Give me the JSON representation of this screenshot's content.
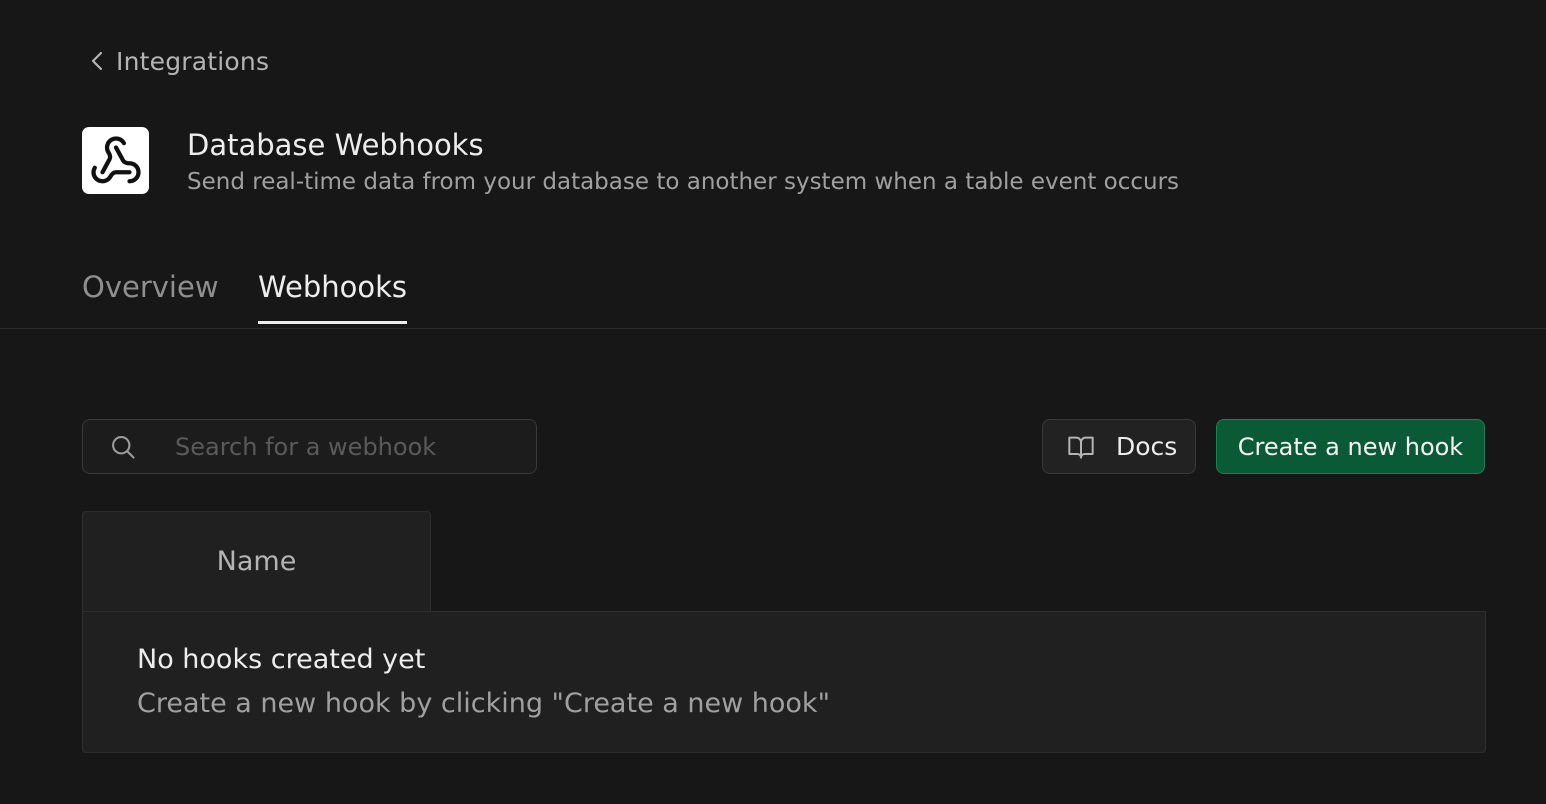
{
  "breadcrumb": {
    "back_label": "Integrations",
    "back_icon": "chevron-left-icon"
  },
  "header": {
    "logo_icon": "webhook-icon",
    "title": "Database Webhooks",
    "subtitle": "Send real-time data from your database to another system when a table event occurs"
  },
  "tabs": [
    {
      "label": "Overview",
      "active": false
    },
    {
      "label": "Webhooks",
      "active": true
    }
  ],
  "toolbar": {
    "search": {
      "placeholder": "Search for a webhook",
      "value": "",
      "icon": "search-icon"
    },
    "docs_label": "Docs",
    "docs_icon": "book-icon",
    "create_label": "Create a new hook"
  },
  "table": {
    "columns": [
      "Name"
    ],
    "empty": {
      "title": "No hooks created yet",
      "description": "Create a new hook by clicking \"Create a new hook\""
    }
  },
  "colors": {
    "background": "#171717",
    "primary_button": "#0b5a36",
    "text": "#ededed",
    "muted_text": "#a0a0a0"
  }
}
